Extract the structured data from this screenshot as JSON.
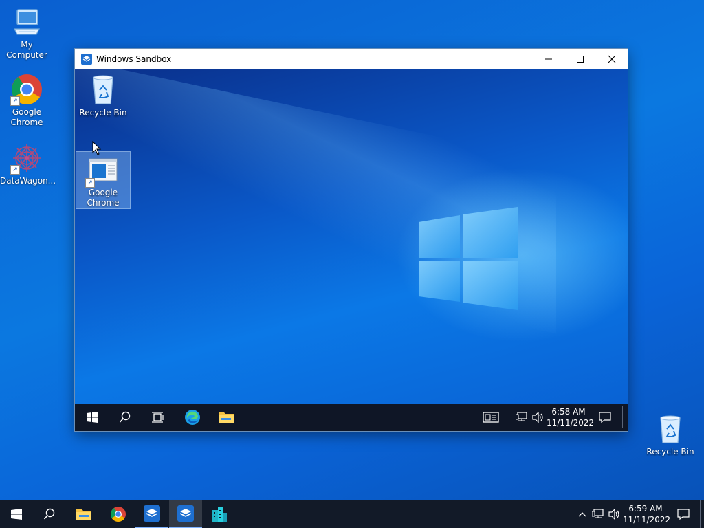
{
  "host": {
    "desktop_icons": [
      {
        "label": "My Computer"
      },
      {
        "label": "Google Chrome"
      },
      {
        "label": "DataWagon..."
      },
      {
        "label": "Recycle Bin"
      }
    ],
    "taskbar": {
      "time": "6:59 AM",
      "date": "11/11/2022"
    }
  },
  "sandbox": {
    "title": "Windows Sandbox",
    "desktop_icons": [
      {
        "label": "Recycle Bin"
      },
      {
        "label": "Google Chrome"
      }
    ],
    "taskbar": {
      "time": "6:58 AM",
      "date": "11/11/2022"
    }
  },
  "icons": {
    "start": "windows-logo",
    "search": "magnifier",
    "task_view": "task-view",
    "edge": "edge",
    "explorer": "folder",
    "chrome": "chrome",
    "sandbox": "sandbox",
    "datawagon": "buildings"
  },
  "colors": {
    "desktop_blue": "#0b78e0",
    "taskbar_dark": "#121a28",
    "accent": "#7fb2ff"
  }
}
